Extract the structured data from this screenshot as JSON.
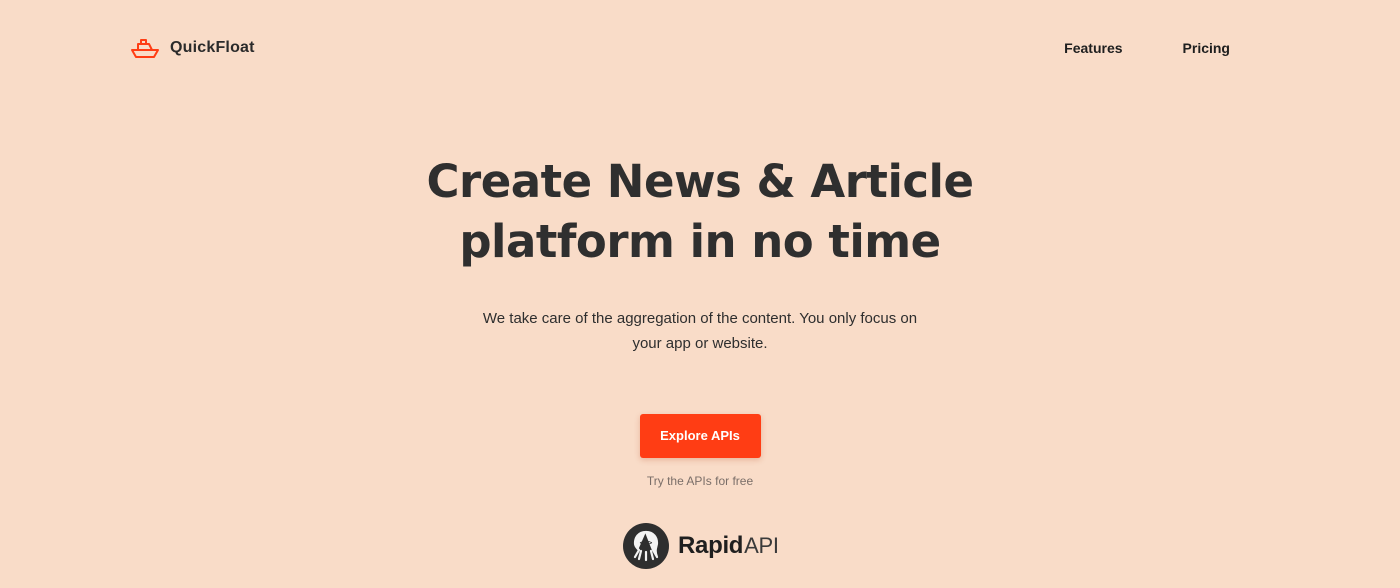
{
  "nav": {
    "brand": "QuickFloat",
    "brand_icon": "boat-icon",
    "links": [
      "Features",
      "Pricing"
    ]
  },
  "hero": {
    "title_line1": "Create News & Article",
    "title_line2": "platform in no time",
    "subtitle_line1": "We take care of the aggregation of the content. You only focus on",
    "subtitle_line2": "your app or website.",
    "cta_label": "Explore APIs",
    "cta_note": "Try the APIs for free"
  },
  "partner": {
    "name": "Rapid",
    "suffix": "API",
    "icon": "rapidapi-octopus-icon"
  },
  "colors": {
    "background": "#f9dcc8",
    "accent": "#ff3d14",
    "text": "#2b2b2b"
  }
}
